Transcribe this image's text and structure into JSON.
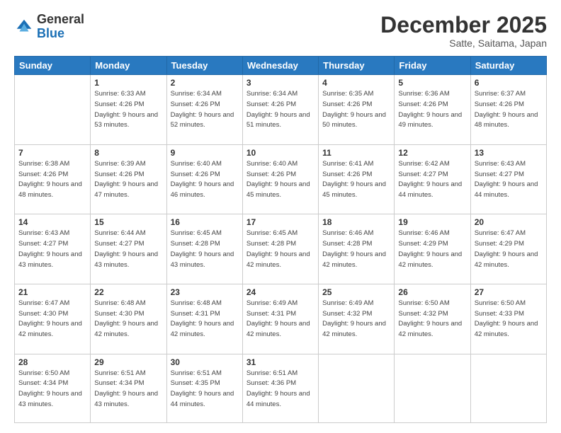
{
  "header": {
    "logo_general": "General",
    "logo_blue": "Blue",
    "month": "December 2025",
    "location": "Satte, Saitama, Japan"
  },
  "days_of_week": [
    "Sunday",
    "Monday",
    "Tuesday",
    "Wednesday",
    "Thursday",
    "Friday",
    "Saturday"
  ],
  "weeks": [
    [
      {
        "day": "",
        "sunrise": "",
        "sunset": "",
        "daylight": ""
      },
      {
        "day": "1",
        "sunrise": "Sunrise: 6:33 AM",
        "sunset": "Sunset: 4:26 PM",
        "daylight": "Daylight: 9 hours and 53 minutes."
      },
      {
        "day": "2",
        "sunrise": "Sunrise: 6:34 AM",
        "sunset": "Sunset: 4:26 PM",
        "daylight": "Daylight: 9 hours and 52 minutes."
      },
      {
        "day": "3",
        "sunrise": "Sunrise: 6:34 AM",
        "sunset": "Sunset: 4:26 PM",
        "daylight": "Daylight: 9 hours and 51 minutes."
      },
      {
        "day": "4",
        "sunrise": "Sunrise: 6:35 AM",
        "sunset": "Sunset: 4:26 PM",
        "daylight": "Daylight: 9 hours and 50 minutes."
      },
      {
        "day": "5",
        "sunrise": "Sunrise: 6:36 AM",
        "sunset": "Sunset: 4:26 PM",
        "daylight": "Daylight: 9 hours and 49 minutes."
      },
      {
        "day": "6",
        "sunrise": "Sunrise: 6:37 AM",
        "sunset": "Sunset: 4:26 PM",
        "daylight": "Daylight: 9 hours and 48 minutes."
      }
    ],
    [
      {
        "day": "7",
        "sunrise": "Sunrise: 6:38 AM",
        "sunset": "Sunset: 4:26 PM",
        "daylight": "Daylight: 9 hours and 48 minutes."
      },
      {
        "day": "8",
        "sunrise": "Sunrise: 6:39 AM",
        "sunset": "Sunset: 4:26 PM",
        "daylight": "Daylight: 9 hours and 47 minutes."
      },
      {
        "day": "9",
        "sunrise": "Sunrise: 6:40 AM",
        "sunset": "Sunset: 4:26 PM",
        "daylight": "Daylight: 9 hours and 46 minutes."
      },
      {
        "day": "10",
        "sunrise": "Sunrise: 6:40 AM",
        "sunset": "Sunset: 4:26 PM",
        "daylight": "Daylight: 9 hours and 45 minutes."
      },
      {
        "day": "11",
        "sunrise": "Sunrise: 6:41 AM",
        "sunset": "Sunset: 4:26 PM",
        "daylight": "Daylight: 9 hours and 45 minutes."
      },
      {
        "day": "12",
        "sunrise": "Sunrise: 6:42 AM",
        "sunset": "Sunset: 4:27 PM",
        "daylight": "Daylight: 9 hours and 44 minutes."
      },
      {
        "day": "13",
        "sunrise": "Sunrise: 6:43 AM",
        "sunset": "Sunset: 4:27 PM",
        "daylight": "Daylight: 9 hours and 44 minutes."
      }
    ],
    [
      {
        "day": "14",
        "sunrise": "Sunrise: 6:43 AM",
        "sunset": "Sunset: 4:27 PM",
        "daylight": "Daylight: 9 hours and 43 minutes."
      },
      {
        "day": "15",
        "sunrise": "Sunrise: 6:44 AM",
        "sunset": "Sunset: 4:27 PM",
        "daylight": "Daylight: 9 hours and 43 minutes."
      },
      {
        "day": "16",
        "sunrise": "Sunrise: 6:45 AM",
        "sunset": "Sunset: 4:28 PM",
        "daylight": "Daylight: 9 hours and 43 minutes."
      },
      {
        "day": "17",
        "sunrise": "Sunrise: 6:45 AM",
        "sunset": "Sunset: 4:28 PM",
        "daylight": "Daylight: 9 hours and 42 minutes."
      },
      {
        "day": "18",
        "sunrise": "Sunrise: 6:46 AM",
        "sunset": "Sunset: 4:28 PM",
        "daylight": "Daylight: 9 hours and 42 minutes."
      },
      {
        "day": "19",
        "sunrise": "Sunrise: 6:46 AM",
        "sunset": "Sunset: 4:29 PM",
        "daylight": "Daylight: 9 hours and 42 minutes."
      },
      {
        "day": "20",
        "sunrise": "Sunrise: 6:47 AM",
        "sunset": "Sunset: 4:29 PM",
        "daylight": "Daylight: 9 hours and 42 minutes."
      }
    ],
    [
      {
        "day": "21",
        "sunrise": "Sunrise: 6:47 AM",
        "sunset": "Sunset: 4:30 PM",
        "daylight": "Daylight: 9 hours and 42 minutes."
      },
      {
        "day": "22",
        "sunrise": "Sunrise: 6:48 AM",
        "sunset": "Sunset: 4:30 PM",
        "daylight": "Daylight: 9 hours and 42 minutes."
      },
      {
        "day": "23",
        "sunrise": "Sunrise: 6:48 AM",
        "sunset": "Sunset: 4:31 PM",
        "daylight": "Daylight: 9 hours and 42 minutes."
      },
      {
        "day": "24",
        "sunrise": "Sunrise: 6:49 AM",
        "sunset": "Sunset: 4:31 PM",
        "daylight": "Daylight: 9 hours and 42 minutes."
      },
      {
        "day": "25",
        "sunrise": "Sunrise: 6:49 AM",
        "sunset": "Sunset: 4:32 PM",
        "daylight": "Daylight: 9 hours and 42 minutes."
      },
      {
        "day": "26",
        "sunrise": "Sunrise: 6:50 AM",
        "sunset": "Sunset: 4:32 PM",
        "daylight": "Daylight: 9 hours and 42 minutes."
      },
      {
        "day": "27",
        "sunrise": "Sunrise: 6:50 AM",
        "sunset": "Sunset: 4:33 PM",
        "daylight": "Daylight: 9 hours and 42 minutes."
      }
    ],
    [
      {
        "day": "28",
        "sunrise": "Sunrise: 6:50 AM",
        "sunset": "Sunset: 4:34 PM",
        "daylight": "Daylight: 9 hours and 43 minutes."
      },
      {
        "day": "29",
        "sunrise": "Sunrise: 6:51 AM",
        "sunset": "Sunset: 4:34 PM",
        "daylight": "Daylight: 9 hours and 43 minutes."
      },
      {
        "day": "30",
        "sunrise": "Sunrise: 6:51 AM",
        "sunset": "Sunset: 4:35 PM",
        "daylight": "Daylight: 9 hours and 44 minutes."
      },
      {
        "day": "31",
        "sunrise": "Sunrise: 6:51 AM",
        "sunset": "Sunset: 4:36 PM",
        "daylight": "Daylight: 9 hours and 44 minutes."
      },
      {
        "day": "",
        "sunrise": "",
        "sunset": "",
        "daylight": ""
      },
      {
        "day": "",
        "sunrise": "",
        "sunset": "",
        "daylight": ""
      },
      {
        "day": "",
        "sunrise": "",
        "sunset": "",
        "daylight": ""
      }
    ]
  ]
}
